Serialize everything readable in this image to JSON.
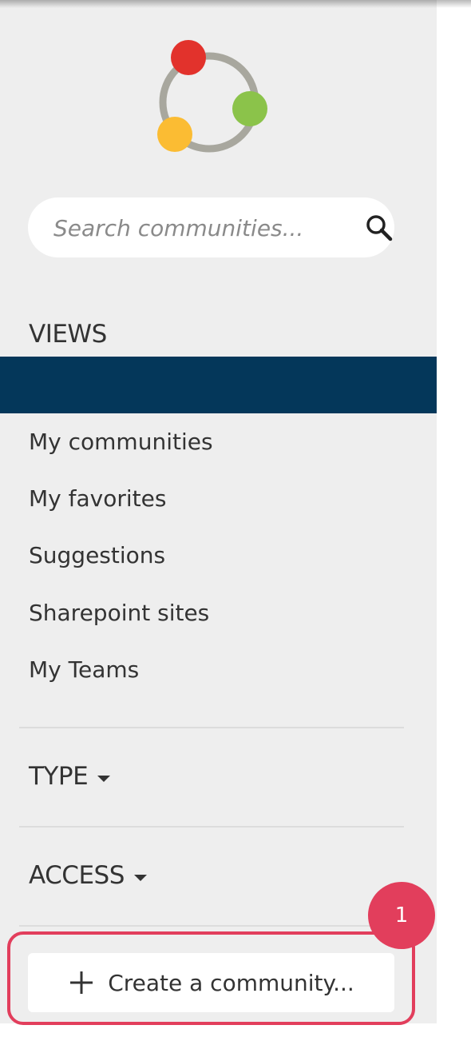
{
  "search": {
    "placeholder": "Search communities..."
  },
  "views": {
    "title": "VIEWS",
    "items": [
      {
        "label": "My communities"
      },
      {
        "label": "My favorites"
      },
      {
        "label": "Suggestions"
      },
      {
        "label": "Sharepoint sites"
      },
      {
        "label": "My Teams"
      }
    ]
  },
  "filters": {
    "type_label": "TYPE",
    "access_label": "ACCESS"
  },
  "create_button": {
    "label": "Create a community..."
  },
  "annotation": {
    "badge": "1"
  },
  "colors": {
    "sidebar_bg": "#eeeeee",
    "active_bar": "#04375a",
    "highlight": "#e23e5c",
    "logo_red": "#e2322c",
    "logo_green": "#8bc34a",
    "logo_yellow": "#fbbc33",
    "logo_ring": "#a8a79e"
  },
  "icons": [
    "app-logo-icon",
    "search-icon",
    "caret-down-icon",
    "plus-icon"
  ]
}
